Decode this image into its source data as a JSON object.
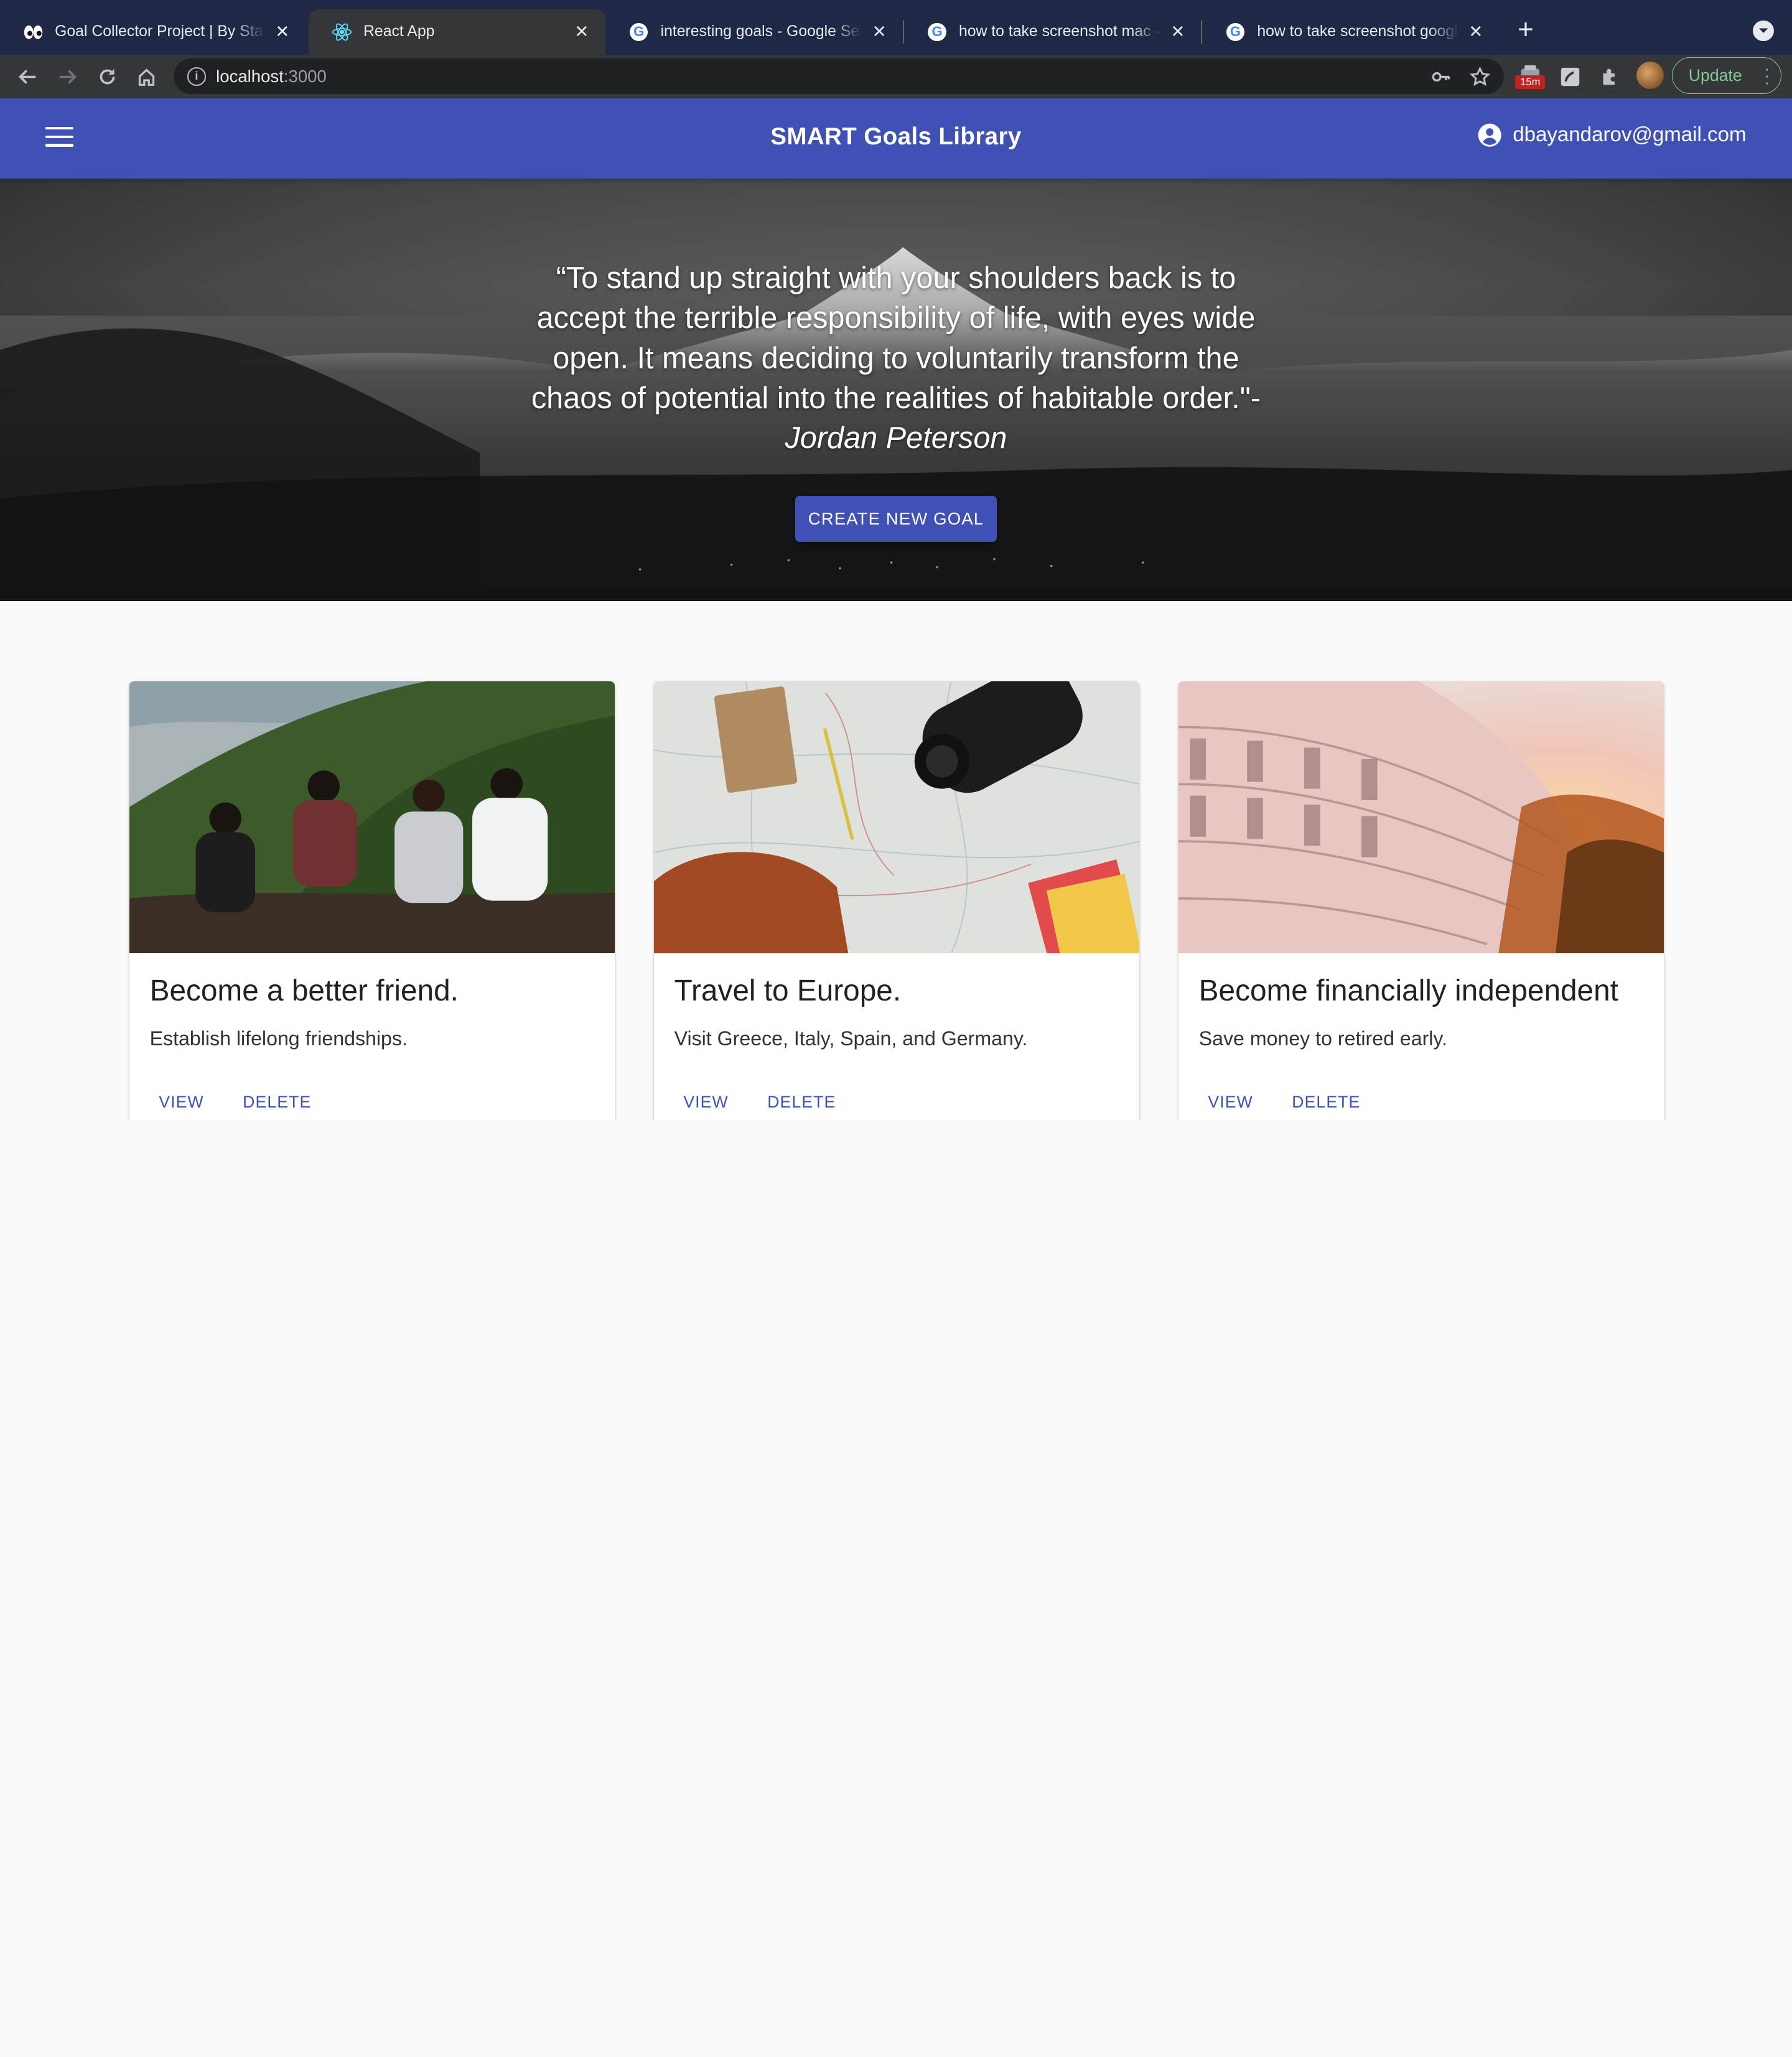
{
  "browser": {
    "tabs": [
      {
        "title": "Goal Collector Project | By Stat",
        "icon": "eyes-emoji-icon",
        "active": false
      },
      {
        "title": "React App",
        "icon": "react-icon",
        "active": true
      },
      {
        "title": "interesting goals - Google Sear",
        "icon": "google-icon",
        "active": false
      },
      {
        "title": "how to take screenshot mac - G",
        "icon": "google-icon",
        "active": false
      },
      {
        "title": "how to take screenshot google",
        "icon": "google-icon",
        "active": false
      }
    ],
    "new_tab": "+",
    "url_host": "localhost",
    "url_port": ":3000",
    "extension_badge": "15m",
    "update_label": "Update"
  },
  "appbar": {
    "title": "SMART Goals Library",
    "user_email": "dbayandarov@gmail.com"
  },
  "hero": {
    "quote": "“To stand up straight with your shoulders back is to accept the terrible responsibility of life, with eyes wide open. It means deciding to voluntarily transform the chaos of potential into the realities of habitable order.\"- ",
    "author": "Jordan Peterson",
    "cta_label": "CREATE NEW GOAL"
  },
  "cards": [
    {
      "title": "Become a better friend.",
      "description": "Establish lifelong friendships.",
      "view_label": "VIEW",
      "delete_label": "DELETE",
      "image": "friends-on-hill"
    },
    {
      "title": "Travel to Europe.",
      "description": "Visit Greece, Italy, Spain, and Germany.",
      "view_label": "VIEW",
      "delete_label": "DELETE",
      "image": "map-camera-notebook"
    },
    {
      "title": "Become financially independent",
      "description": "Save money to retired early.",
      "view_label": "VIEW",
      "delete_label": "DELETE",
      "image": "building-sunset"
    }
  ],
  "colors": {
    "primary": "#3f51b5",
    "tabstrip": "#1f2845",
    "toolbar": "#35363a",
    "omnibox": "#202124",
    "update_green": "#81c995"
  }
}
